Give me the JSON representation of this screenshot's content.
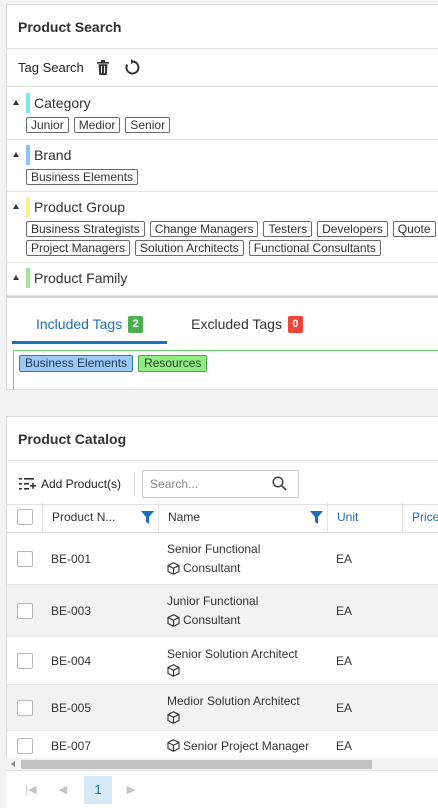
{
  "search_panel": {
    "title": "Product Search",
    "tag_search_label": "Tag Search",
    "groups": [
      {
        "name": "Category",
        "color": "#7ee8e8",
        "tags": [
          "Junior",
          "Medior",
          "Senior"
        ]
      },
      {
        "name": "Brand",
        "color": "#88c4f2",
        "tags": [
          "Business Elements"
        ]
      },
      {
        "name": "Product Group",
        "color": "#fff18a",
        "tags": [
          "Business Strategists",
          "Change Managers",
          "Testers",
          "Developers",
          "Quote",
          "Project Managers",
          "Solution Architects",
          "Functional Consultants"
        ]
      },
      {
        "name": "Product Family",
        "color": "#9de89d",
        "tags": []
      }
    ],
    "tabs": [
      {
        "label": "Included Tags",
        "count": "2",
        "active": true
      },
      {
        "label": "Excluded Tags",
        "count": "0",
        "active": false
      }
    ],
    "included_tags": [
      "Business Elements",
      "Resources"
    ]
  },
  "catalog_panel": {
    "title": "Product Catalog",
    "add_label": "Add Product(s)",
    "search_placeholder": "Search...",
    "columns": [
      "Product N...",
      "Name",
      "Unit",
      "Price"
    ],
    "rows": [
      {
        "pn": "BE-001",
        "name1": "Senior Functional",
        "name2": "Consultant",
        "unit": "EA"
      },
      {
        "pn": "BE-003",
        "name1": "Junior Functional",
        "name2": "Consultant",
        "unit": "EA"
      },
      {
        "pn": "BE-004",
        "name1": "Senior Solution Architect",
        "name2": "",
        "unit": "EA"
      },
      {
        "pn": "BE-005",
        "name1": "Medior Solution Architect",
        "name2": "",
        "unit": "EA"
      },
      {
        "pn": "BE-007",
        "name1": "",
        "name2": "Senior Project Manager",
        "unit": "EA"
      }
    ],
    "pager": {
      "current_page": "1"
    }
  }
}
